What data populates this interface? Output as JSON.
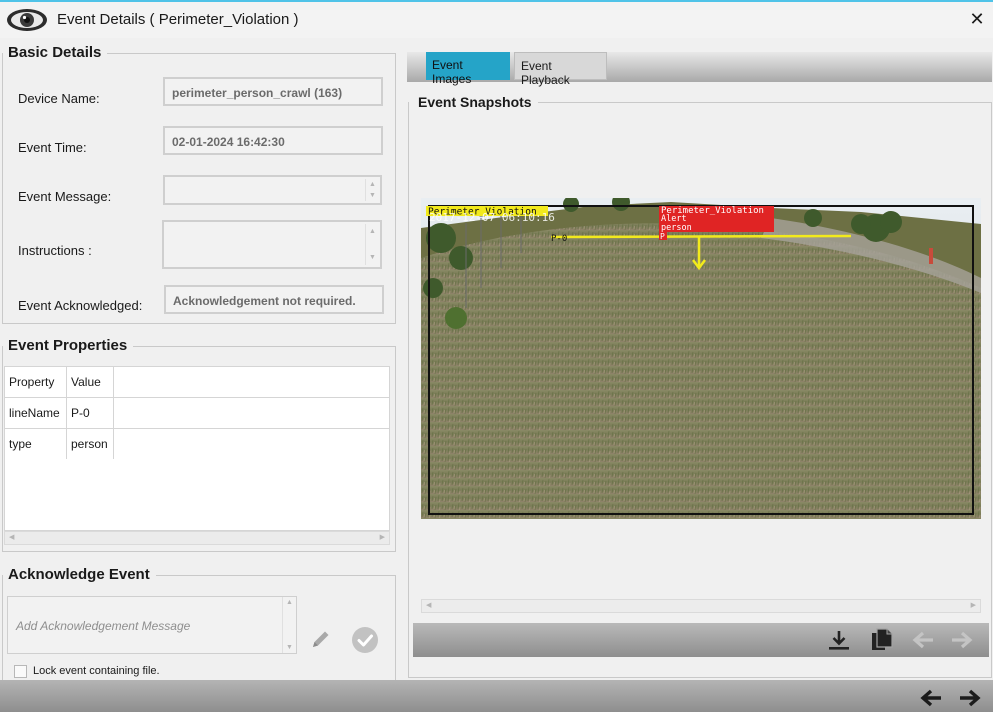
{
  "window": {
    "title": "Event Details ( Perimeter_Violation )",
    "close_glyph": "✕",
    "icon": "eye-icon"
  },
  "basic_details": {
    "heading": "Basic Details",
    "device_name_label": "Device Name:",
    "device_name_value": "perimeter_person_crawl (163)",
    "event_time_label": "Event Time:",
    "event_time_value": "02-01-2024 16:42:30",
    "event_message_label": "Event Message:",
    "event_message_value": "",
    "instructions_label": "Instructions :",
    "instructions_value": "",
    "event_ack_label": "Event Acknowledged:",
    "event_ack_value": "Acknowledgement not required."
  },
  "event_properties": {
    "heading": "Event Properties",
    "columns": [
      "Property",
      "Value"
    ],
    "rows": [
      {
        "property": "lineName",
        "value": "P-0"
      },
      {
        "property": "type",
        "value": "person"
      }
    ]
  },
  "acknowledge": {
    "heading": "Acknowledge Event",
    "placeholder": "Add Acknowledgement Message",
    "lock_label": "Lock event containing file.",
    "lock_checked": false
  },
  "tabs": [
    {
      "label": "Event Images",
      "active": true
    },
    {
      "label": "Event Playback",
      "active": false
    }
  ],
  "snapshots": {
    "heading": "Event Snapshots",
    "overlay_label_left": "Perimeter_Violation",
    "overlay_timestamp": "2017-12-07 06:10:16",
    "overlay_line_label": "P-0",
    "overlay_alert_title": "Perimeter_Violation",
    "overlay_alert_line2": "Alert",
    "overlay_alert_line3": "person",
    "overlay_alert_line4": "P",
    "toolbar_icons": [
      "download-icon",
      "copy-icon",
      "prev-image-icon",
      "next-image-icon"
    ]
  },
  "footer": {
    "icons": [
      "prev-event-icon",
      "next-event-icon"
    ]
  },
  "colors": {
    "accent_tab": "#25a4c8",
    "title_strip": "#4fc3e8",
    "overlay_yellow": "#f2ea1c",
    "overlay_red": "#e02424"
  }
}
